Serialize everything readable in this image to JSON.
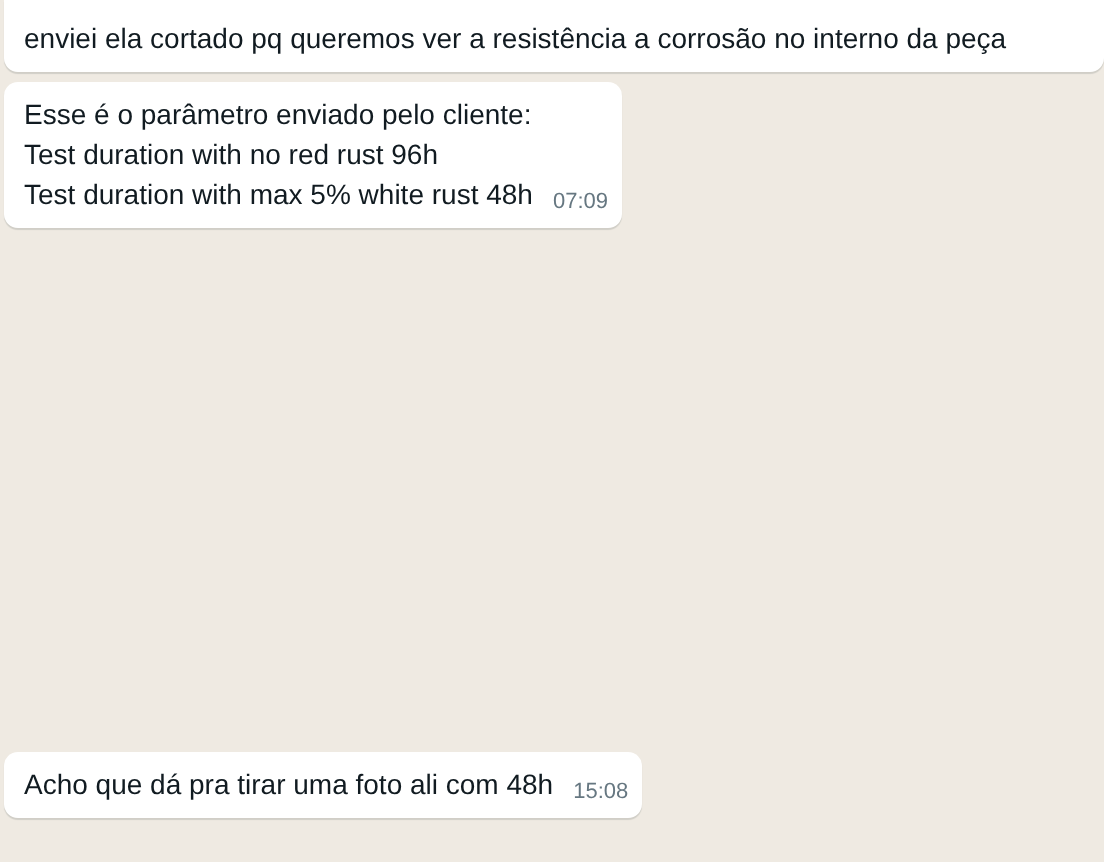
{
  "messages": [
    {
      "text": "enviei ela cortado pq queremos ver a resistência a corrosão no interno da peça"
    },
    {
      "text": "Esse é o parâmetro enviado pelo cliente:\nTest duration with no red rust 96h\nTest duration with max 5% white rust 48h",
      "time": "07:09"
    },
    {
      "text": "Acho que dá pra tirar uma foto ali com 48h",
      "time": "15:08"
    }
  ]
}
